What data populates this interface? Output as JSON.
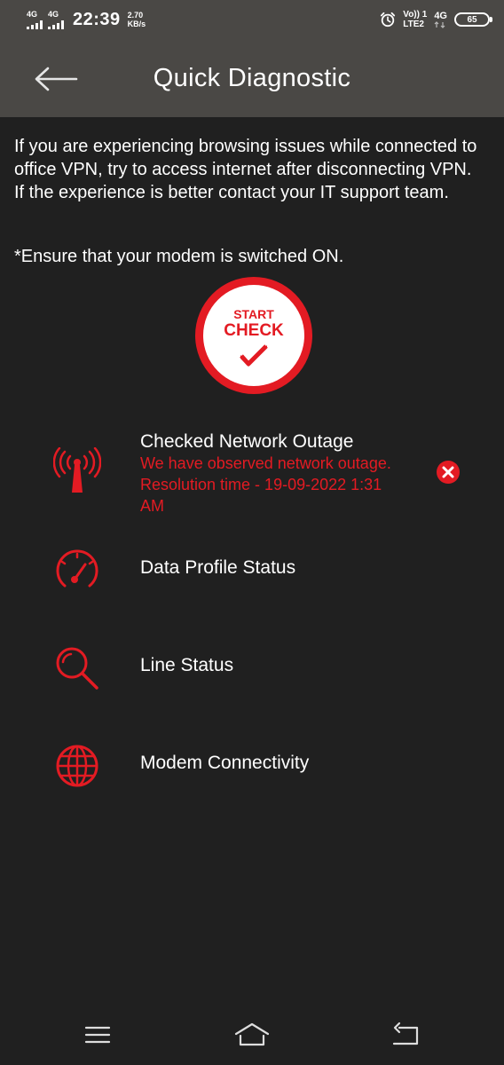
{
  "status_bar": {
    "sim1_network": "4G",
    "sim2_network": "4G",
    "time": "22:39",
    "speed_value": "2.70",
    "speed_unit": "KB/s",
    "volte_top": "Vo)) 1",
    "volte_bottom": "LTE2",
    "right_network": "4G",
    "battery": "65"
  },
  "header": {
    "title": "Quick Diagnostic",
    "back_icon": "arrow-left-icon"
  },
  "info": {
    "message": "If you are experiencing browsing issues while connected to office VPN, try to access internet after disconnecting VPN. If the experience is better contact your IT support team.",
    "note": "*Ensure that your modem is switched ON."
  },
  "start_button": {
    "line1": "START",
    "line2": "CHECK",
    "icon": "checkmark-icon"
  },
  "checks": [
    {
      "label": "Checked Network Outage",
      "message": "We have observed network outage. Resolution time - 19-09-2022 1:31 AM",
      "icon": "tower-icon",
      "status_icon": "error-x-icon"
    },
    {
      "label": "Data Profile Status",
      "icon": "speedometer-icon"
    },
    {
      "label": "Line Status",
      "icon": "search-icon"
    },
    {
      "label": "Modem Connectivity",
      "icon": "globe-icon"
    }
  ],
  "nav": {
    "menu_icon": "menu-icon",
    "home_icon": "home-icon",
    "back_icon": "back-icon"
  },
  "colors": {
    "accent": "#e31b23",
    "header_bg": "#4a4845",
    "page_bg": "#202020"
  }
}
